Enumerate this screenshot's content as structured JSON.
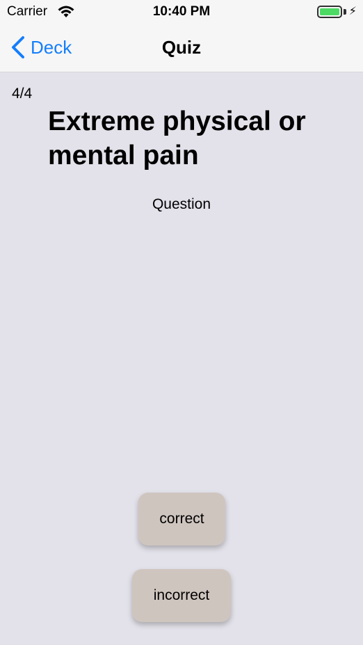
{
  "status_bar": {
    "carrier": "Carrier",
    "time": "10:40 PM",
    "battery_level": 1.0,
    "battery_color": "#4cd964",
    "charging_icon": "bolt-icon",
    "wifi_icon": "wifi-icon"
  },
  "nav": {
    "back_label": "Deck",
    "back_icon": "chevron-left-icon",
    "title": "Quiz",
    "accent_color": "#157efb"
  },
  "quiz": {
    "progress": "4/4",
    "card_text": "Extreme physical or mental pain",
    "toggle_label": "Question"
  },
  "buttons": {
    "correct_label": "correct",
    "incorrect_label": "incorrect",
    "button_color": "#cfc5bf"
  }
}
